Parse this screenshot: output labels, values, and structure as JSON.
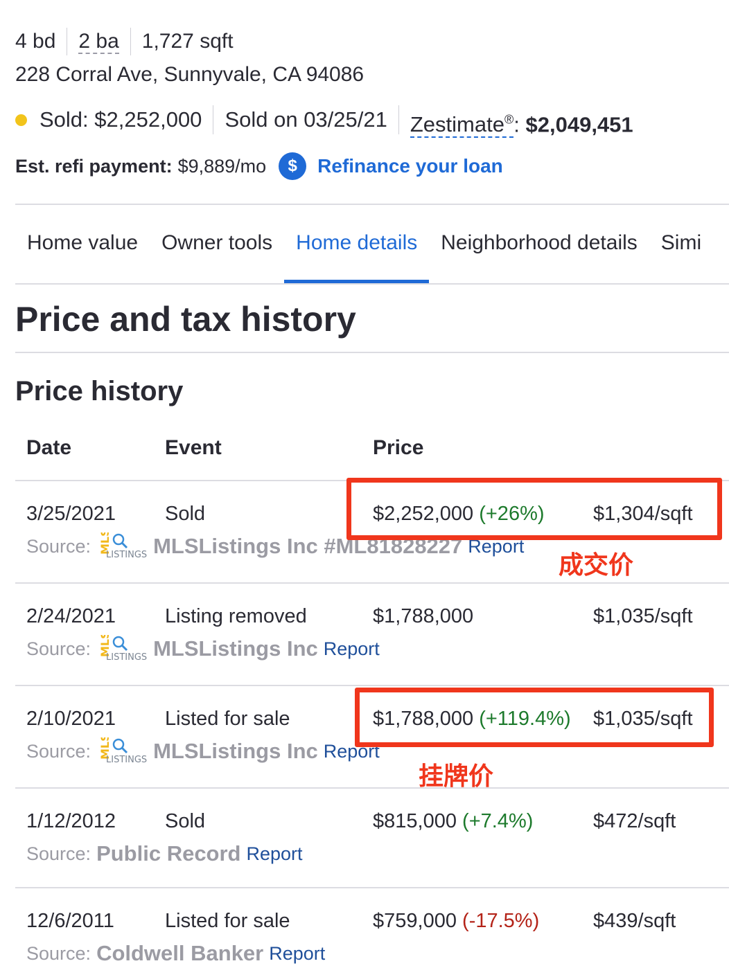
{
  "facts": {
    "beds": "4 bd",
    "baths": "2 ba",
    "sqft": "1,727 sqft"
  },
  "address": "228 Corral Ave, Sunnyvale, CA 94086",
  "status": {
    "sold_label": "Sold: $2,252,000",
    "sold_date": "Sold on 03/25/21",
    "zestimate_label": "Zestimate",
    "zestimate_mark": "®",
    "zestimate_sep": ":",
    "zestimate_value": "$2,049,451",
    "dot_color": "#f2c41b"
  },
  "refi": {
    "label": "Est. refi payment:",
    "value": "$9,889/mo",
    "badge": "$",
    "link": "Refinance your loan"
  },
  "tabs": [
    {
      "label": "Home value"
    },
    {
      "label": "Owner tools"
    },
    {
      "label": "Home details",
      "active": true
    },
    {
      "label": "Neighborhood details"
    },
    {
      "label": "Simi"
    }
  ],
  "section_title": "Price and tax history",
  "subsection_title": "Price history",
  "table": {
    "headers": {
      "date": "Date",
      "event": "Event",
      "price": "Price"
    },
    "rows": [
      {
        "date": "3/25/2021",
        "event": "Sold",
        "price": "$2,252,000",
        "change": "(+26%)",
        "change_dir": "up",
        "per_sqft": "$1,304/sqft",
        "source_label": "Source:",
        "source_logo": "mls-listings-logo",
        "source": "MLSListings Inc #ML81828227",
        "report": "Report"
      },
      {
        "date": "2/24/2021",
        "event": "Listing removed",
        "price": "$1,788,000",
        "change": "",
        "change_dir": "",
        "per_sqft": "$1,035/sqft",
        "source_label": "Source:",
        "source_logo": "mls-listings-logo",
        "source": "MLSListings Inc",
        "report": "Report"
      },
      {
        "date": "2/10/2021",
        "event": "Listed for sale",
        "price": "$1,788,000",
        "change": "(+119.4%)",
        "change_dir": "up",
        "per_sqft": "$1,035/sqft",
        "source_label": "Source:",
        "source_logo": "mls-listings-logo",
        "source": "MLSListings Inc",
        "report": "Report"
      },
      {
        "date": "1/12/2012",
        "event": "Sold",
        "price": "$815,000",
        "change": "(+7.4%)",
        "change_dir": "up",
        "per_sqft": "$472/sqft",
        "source_label": "Source:",
        "source_logo": "",
        "source": "Public Record",
        "report": "Report"
      },
      {
        "date": "12/6/2011",
        "event": "Listed for sale",
        "price": "$759,000",
        "change": "(-17.5%)",
        "change_dir": "down",
        "per_sqft": "$439/sqft",
        "source_label": "Source:",
        "source_logo": "",
        "source": "Coldwell Banker",
        "report": "Report"
      }
    ]
  },
  "annotations": {
    "sold_price_note": "成交价",
    "list_price_note": "挂牌价",
    "highlight_color": "#f0361c"
  },
  "colors": {
    "accent": "#1f6ad6",
    "text": "#2a2a33",
    "gain": "#1d7a2c",
    "loss": "#b42318",
    "muted": "#9b9ba3"
  }
}
